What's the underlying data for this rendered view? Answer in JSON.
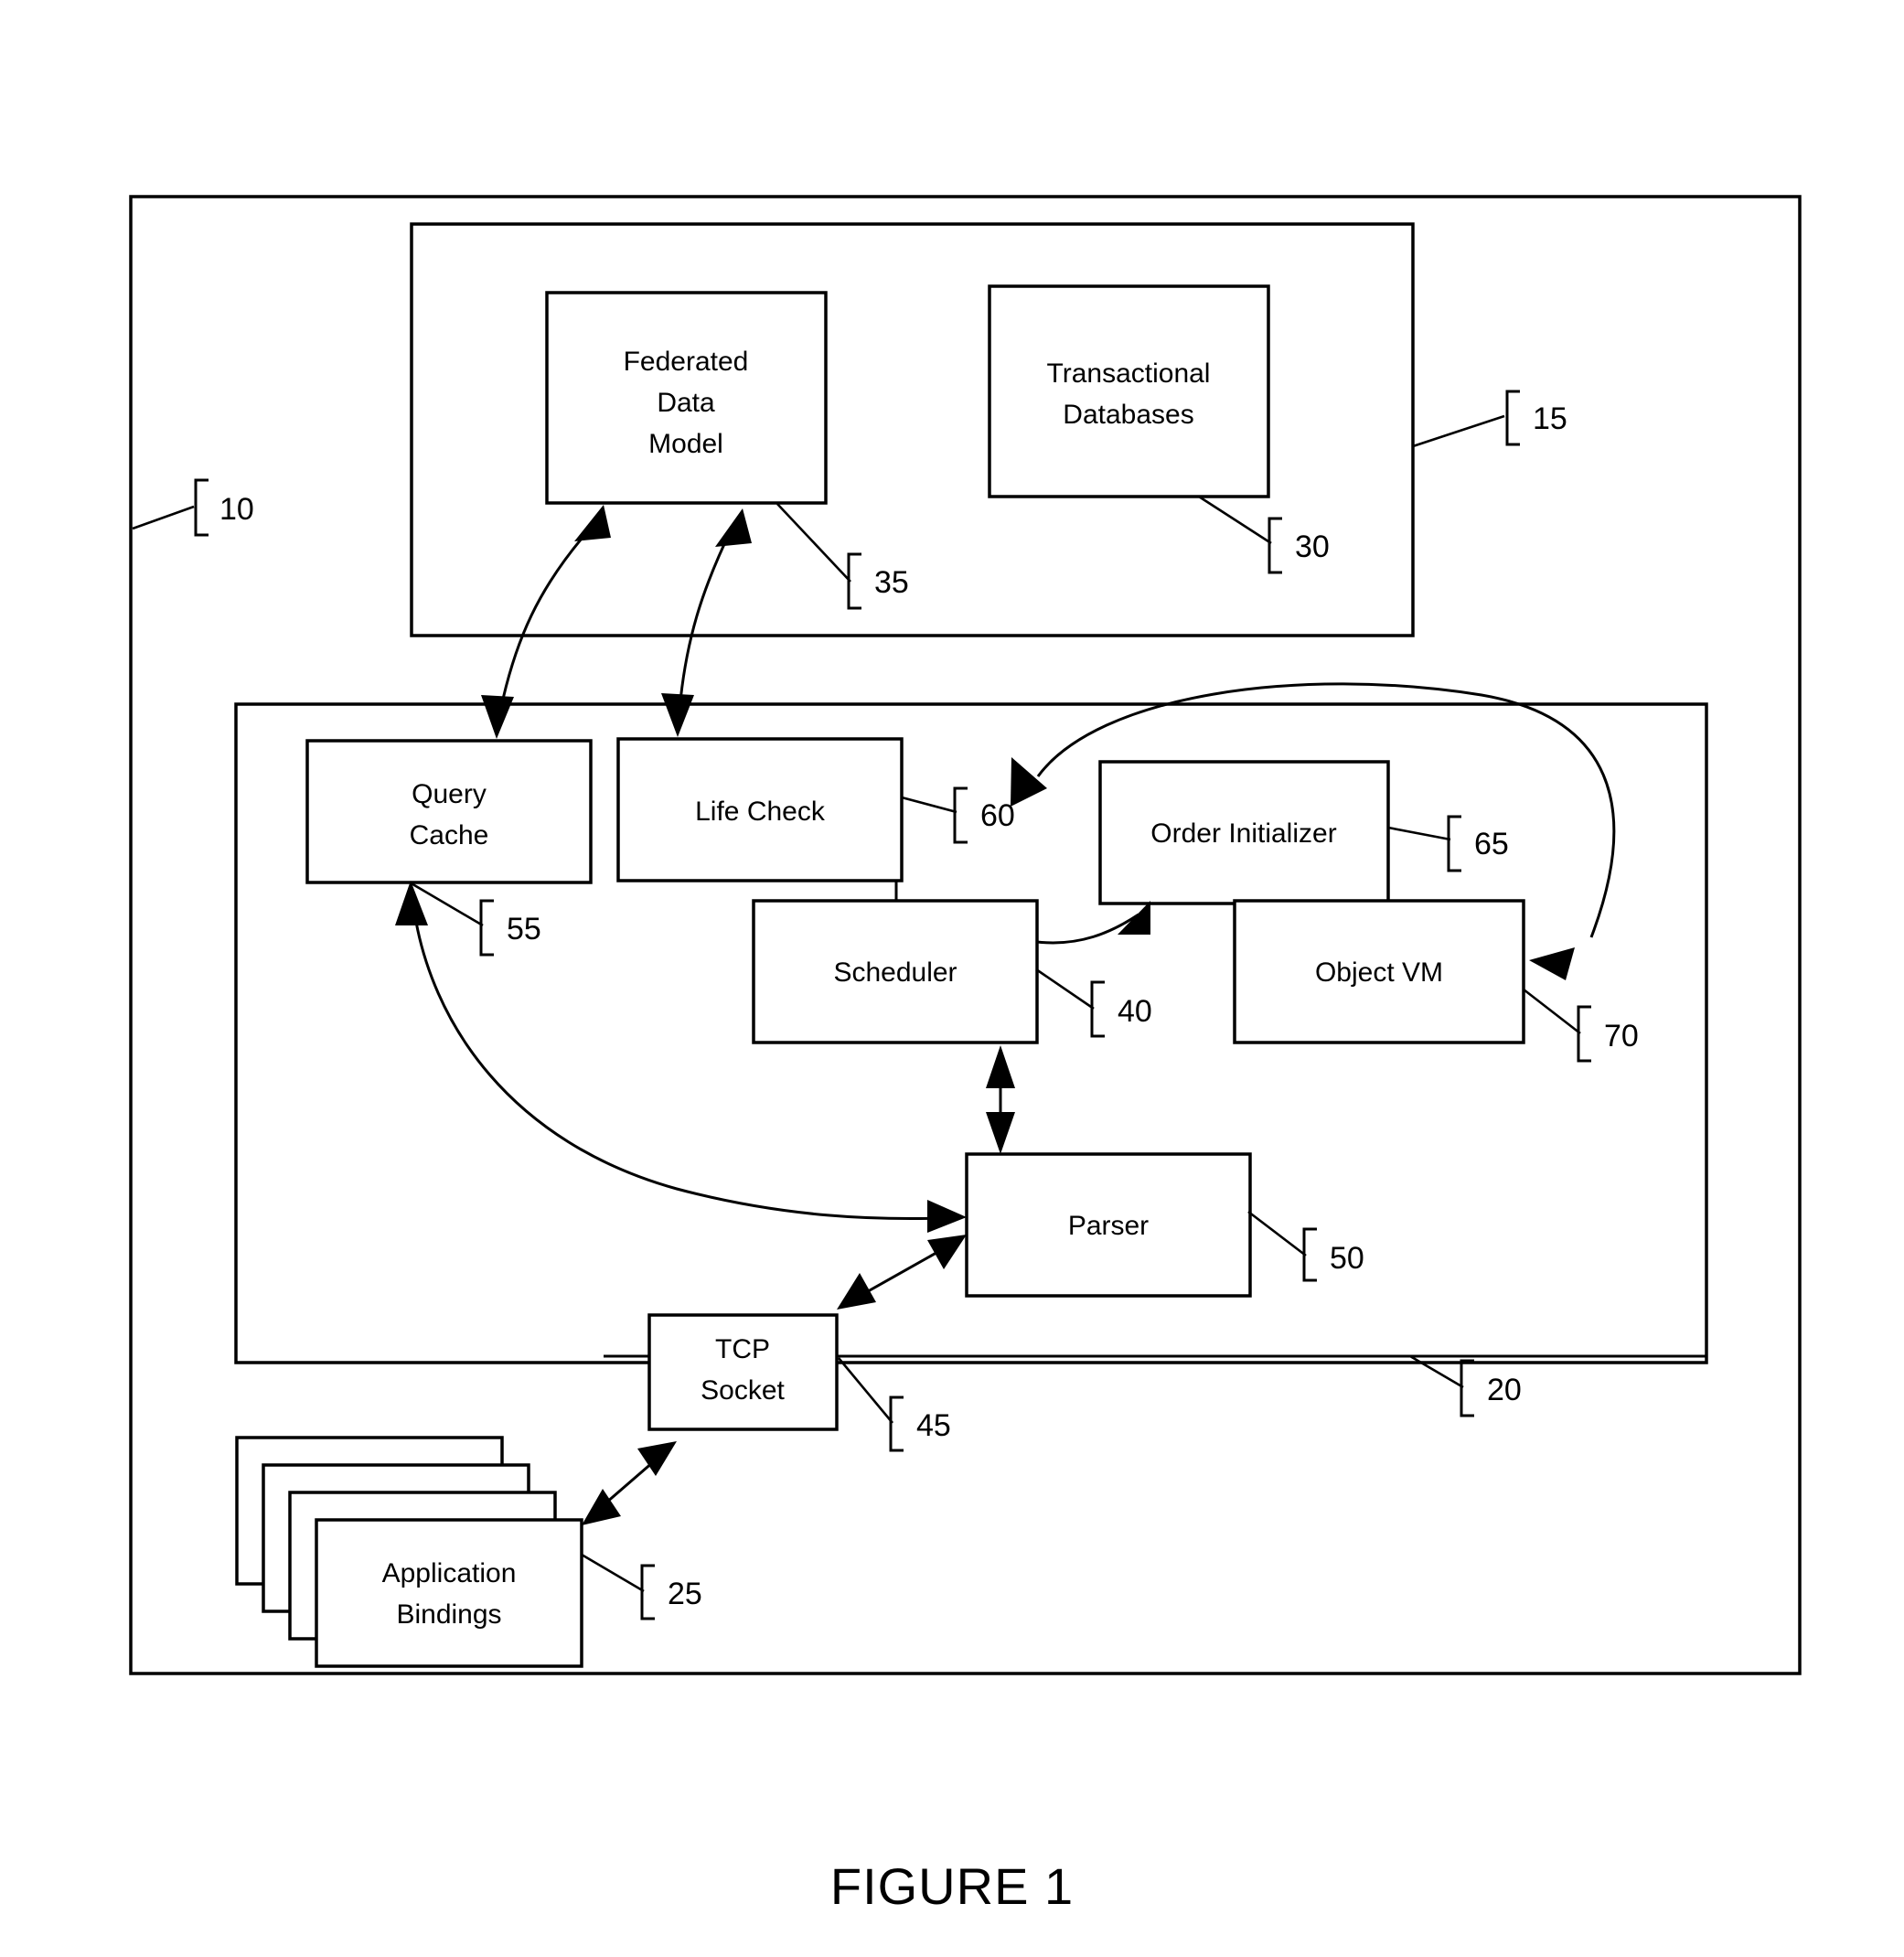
{
  "figure": {
    "caption": "FIGURE 1",
    "system_label": "10",
    "data_layer_label": "15",
    "engine_layer_label": "20"
  },
  "boxes": [
    {
      "id": "federated-data-model",
      "label_lines": [
        "Federated",
        "Data",
        "Model"
      ],
      "ref": "35"
    },
    {
      "id": "transactional-databases",
      "label_lines": [
        "Transactional",
        "Databases"
      ],
      "ref": "30"
    },
    {
      "id": "query-cache",
      "label_lines": [
        "Query",
        "Cache"
      ],
      "ref": "55"
    },
    {
      "id": "life-check",
      "label_lines": [
        "Life Check"
      ],
      "ref": "60"
    },
    {
      "id": "order-initializer",
      "label_lines": [
        "Order Initializer"
      ],
      "ref": "65"
    },
    {
      "id": "scheduler",
      "label_lines": [
        "Scheduler"
      ],
      "ref": "40"
    },
    {
      "id": "object-vm",
      "label_lines": [
        "Object VM"
      ],
      "ref": "70"
    },
    {
      "id": "parser",
      "label_lines": [
        "Parser"
      ],
      "ref": "50"
    },
    {
      "id": "tcp-socket",
      "label_lines": [
        "TCP",
        "Socket"
      ],
      "ref": "45"
    },
    {
      "id": "application-bindings",
      "label_lines": [
        "Application",
        "Bindings"
      ],
      "ref": "25"
    }
  ],
  "text": {
    "federated_l1": "Federated",
    "federated_l2": "Data",
    "federated_l3": "Model",
    "transactional_l1": "Transactional",
    "transactional_l2": "Databases",
    "query_cache_l1": "Query",
    "query_cache_l2": "Cache",
    "life_check_l1": "Life Check",
    "order_initializer_l1": "Order Initializer",
    "scheduler_l1": "Scheduler",
    "object_vm_l1": "Object VM",
    "parser_l1": "Parser",
    "tcp_socket_l1": "TCP",
    "tcp_socket_l2": "Socket",
    "app_bindings_l1": "Application",
    "app_bindings_l2": "Bindings"
  },
  "refs": {
    "r10": "10",
    "r15": "15",
    "r20": "20",
    "r25": "25",
    "r30": "30",
    "r35": "35",
    "r40": "40",
    "r45": "45",
    "r50": "50",
    "r55": "55",
    "r60": "60",
    "r65": "65",
    "r70": "70"
  },
  "colors": {
    "ink": "#000000",
    "paper": "#ffffff"
  }
}
